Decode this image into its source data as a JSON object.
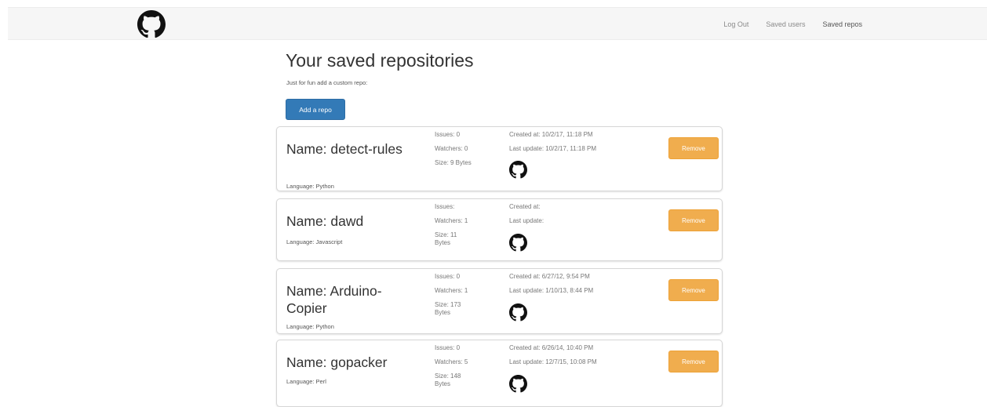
{
  "colors": {
    "navbar_bg": "#f6f6f6",
    "primary": "#337ab7",
    "warning": "#f0ad4e",
    "text": "#333333",
    "muted": "#777777"
  },
  "navbar": {
    "logo_icon": "github-octocat-icon",
    "links": [
      {
        "label": "Log Out"
      },
      {
        "label": "Saved users"
      },
      {
        "label": "Saved repos"
      }
    ]
  },
  "main": {
    "title": "Your saved repositories",
    "subtitle": "Just for fun add a custom repo:",
    "add_button_label": "Add a repo"
  },
  "repos": [
    {
      "name": "Name: detect-rules",
      "language": "Language: Python",
      "issues": "Issues: 0",
      "watchers": "Watchers: 0",
      "size": "Size: 9 Bytes",
      "created": "Created at: 10/2/17, 11:18 PM",
      "updated": "Last update: 10/2/17, 11:18 PM",
      "remove_label": "Remove",
      "link_icon": "github-octocat-icon"
    },
    {
      "name": "Name: dawd",
      "language": "Language: Javascript",
      "issues": "Issues:",
      "watchers": "Watchers: 1",
      "size": "Size: 11 Bytes",
      "created": "Created at:",
      "updated": "Last update:",
      "remove_label": "Remove",
      "link_icon": "github-octocat-icon"
    },
    {
      "name": "Name: Arduino-Copier",
      "language": "Language: Python",
      "issues": "Issues: 0",
      "watchers": "Watchers: 1",
      "size": "Size: 173 Bytes",
      "created": "Created at: 6/27/12, 9:54 PM",
      "updated": "Last update: 1/10/13, 8:44 PM",
      "remove_label": "Remove",
      "link_icon": "github-octocat-icon"
    },
    {
      "name": "Name: gopacker",
      "language": "Language: Perl",
      "issues": "Issues: 0",
      "watchers": "Watchers: 5",
      "size": "Size: 148 Bytes",
      "created": "Created at: 6/26/14, 10:40 PM",
      "updated": "Last update: 12/7/15, 10:08 PM",
      "remove_label": "Remove",
      "link_icon": "github-octocat-icon"
    }
  ]
}
